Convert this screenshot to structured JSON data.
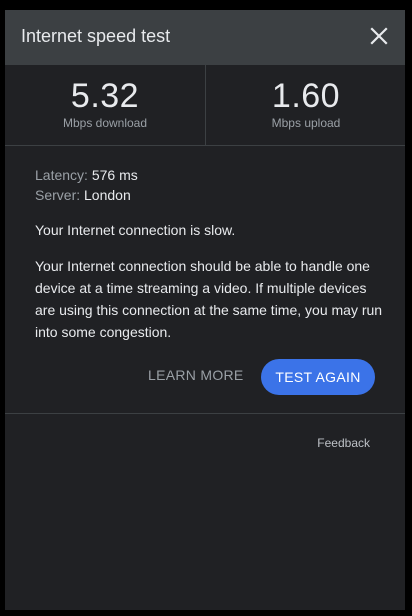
{
  "header": {
    "title": "Internet speed test",
    "close_icon": "close-icon"
  },
  "speeds": {
    "download": {
      "value": "5.32",
      "label": "Mbps download"
    },
    "upload": {
      "value": "1.60",
      "label": "Mbps upload"
    }
  },
  "details": {
    "latency_label": "Latency:",
    "latency_value": "576 ms",
    "server_label": "Server:",
    "server_value": "London"
  },
  "status": "Your Internet connection is slow.",
  "description": "Your Internet connection should be able to handle one device at a time streaming a video. If multiple devices are using this connection at the same time, you may run into some congestion.",
  "actions": {
    "learn_more": "LEARN MORE",
    "test_again": "TEST AGAIN"
  },
  "feedback": "Feedback",
  "colors": {
    "panel_bg": "#202124",
    "header_bg": "#3c4043",
    "accent": "#3b73e8"
  }
}
